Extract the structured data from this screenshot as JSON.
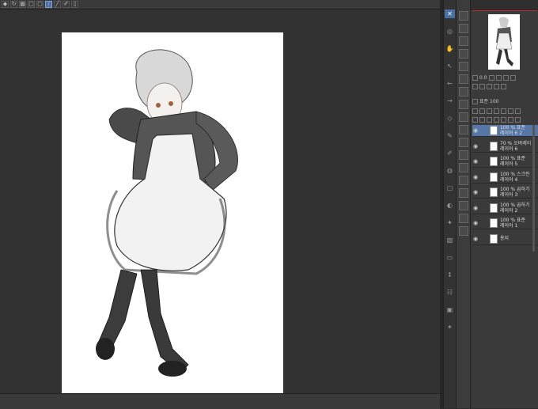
{
  "toolbar": {
    "buttons": [
      {
        "icon": "flip-icon",
        "glyph": "◆"
      },
      {
        "icon": "rotate-icon",
        "glyph": "↻"
      },
      {
        "icon": "grid-icon",
        "glyph": "▦"
      },
      {
        "icon": "box-icon",
        "glyph": "□"
      },
      {
        "icon": "crop-icon",
        "glyph": "▢"
      },
      {
        "icon": "pen-icon",
        "glyph": "∕"
      },
      {
        "icon": "ruler-icon",
        "glyph": "╱"
      },
      {
        "icon": "brush-icon",
        "glyph": "✐"
      },
      {
        "icon": "phone-icon",
        "glyph": "▯"
      }
    ]
  },
  "tools": [
    "✕",
    "◎",
    "✋",
    "↖",
    "←",
    "→",
    "◇",
    "✎",
    "✐",
    "◍",
    "▢",
    "◐",
    "✦",
    "▧",
    "▭",
    "↕",
    "☷",
    "▣",
    "✶"
  ],
  "panel_buttons": [
    "✓",
    "□",
    "◆"
  ],
  "layers": [
    {
      "line1": "100 % 표준",
      "line2": "레이어 6 2",
      "selected": true
    },
    {
      "line1": "70 % 오버레이",
      "line2": "레이어 6",
      "selected": false
    },
    {
      "line1": "100 % 표준",
      "line2": "레이어 5",
      "selected": false
    },
    {
      "line1": "100 % 스크린",
      "line2": "레이어 4",
      "selected": false
    },
    {
      "line1": "100 % 곱하기",
      "line2": "레이어 3",
      "selected": false
    },
    {
      "line1": "100 % 곱하기",
      "line2": "레이어 2",
      "selected": false
    },
    {
      "line1": "100 % 표준",
      "line2": "레이어 1",
      "selected": false
    },
    {
      "line1": "",
      "line2": "용지",
      "selected": false
    }
  ],
  "props": {
    "row1": "0.0",
    "row2": "표준",
    "row3": "100"
  }
}
